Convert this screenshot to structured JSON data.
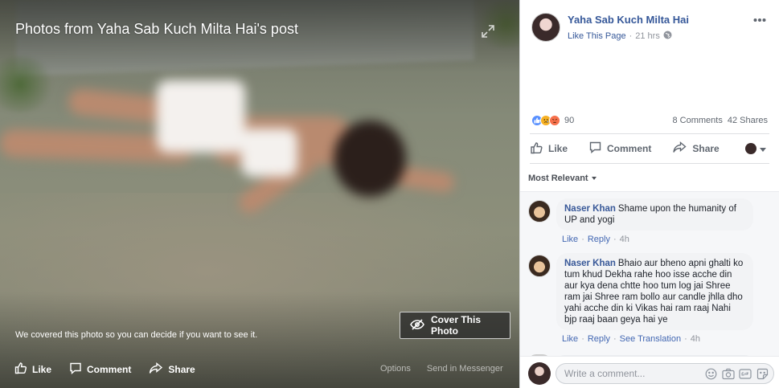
{
  "photo": {
    "title": "Photos from Yaha Sab Kuch Milta Hai's post",
    "cover_notice": "We covered this photo so you can decide if you want to see it.",
    "cover_button_label": "Cover This Photo",
    "actions": {
      "like": "Like",
      "comment": "Comment",
      "share": "Share",
      "options": "Options",
      "send": "Send in Messenger"
    }
  },
  "post": {
    "page_name": "Yaha Sab Kuch Milta Hai",
    "like_page": "Like This Page",
    "time": "21 hrs",
    "reaction_count": "90",
    "comments_count": "8 Comments",
    "shares_count": "42 Shares",
    "actions": {
      "like": "Like",
      "comment": "Comment",
      "share": "Share"
    },
    "sort_label": "Most Relevant"
  },
  "comments": [
    {
      "name": "Naser Khan",
      "text": "Shame upon the humanity of UP and yogi",
      "actions": [
        "Like",
        "Reply"
      ],
      "time": "4h"
    },
    {
      "name": "Naser Khan",
      "text": "Bhaio aur bheno apni ghalti ko tum khud Dekha rahe hoo isse acche din aur kya dena chtte hoo tum log jai Shree ram jai Shree ram bollo aur candle jhlla dho yahi acche din ki Vikas hai ram raaj Nahi bjp raaj baan geya hai ye",
      "actions": [
        "Like",
        "Reply",
        "See Translation"
      ],
      "time": "4h"
    }
  ],
  "composer": {
    "placeholder": "Write a comment..."
  },
  "colors": {
    "link": "#365899",
    "action_blue": "#4267b2",
    "like_blue": "#5890ff",
    "angry": "#f7714c"
  }
}
